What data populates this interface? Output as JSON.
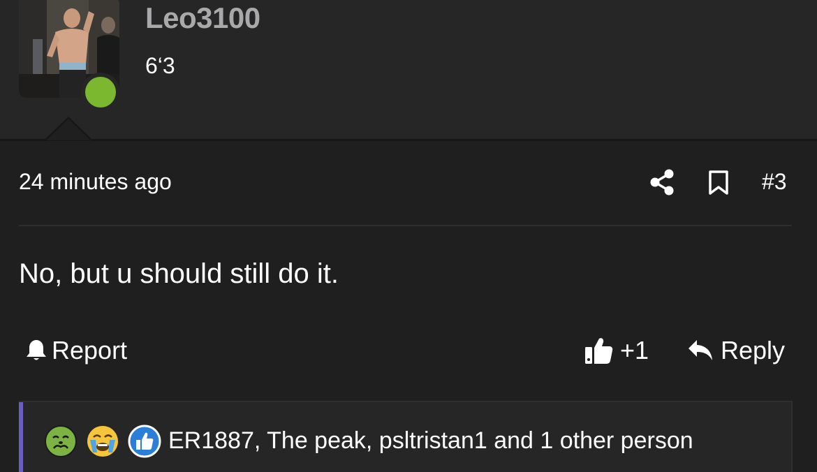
{
  "user": {
    "username": "Leo3100",
    "title": "6‘3",
    "online_color": "#7cb82f"
  },
  "post": {
    "time": "24 minutes ago",
    "number": "#3",
    "message": "No, but u should still do it."
  },
  "actions": {
    "report_label": "Report",
    "like_count": "+1",
    "reply_label": "Reply"
  },
  "reactions": {
    "icons": [
      "nauseated-face-icon",
      "loudly-crying-face-icon",
      "like-icon"
    ],
    "summary": "ER1887, The peak, psltristan1 and 1 other person"
  },
  "colors": {
    "background": "#1f1f20",
    "header": "#262627",
    "username": "#a9a9ab",
    "accent": "#6a5fc1",
    "like_blue": "#2b7fd8"
  }
}
